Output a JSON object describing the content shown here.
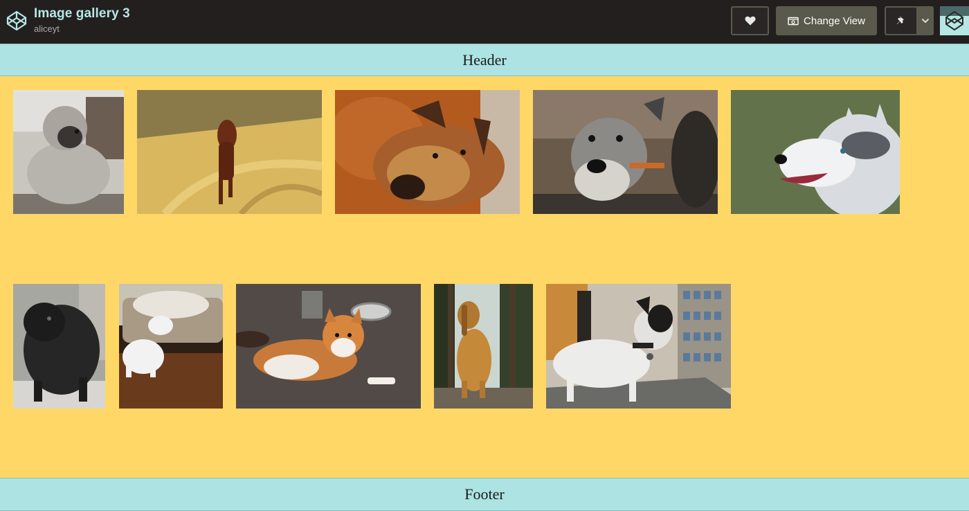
{
  "app": {
    "title": "Image gallery 3",
    "author": "aliceyt"
  },
  "toolbar": {
    "heart_icon": "heart-icon",
    "change_view_label": "Change View",
    "pin_icon": "pin-icon",
    "caret_icon": "chevron-down-icon"
  },
  "page": {
    "header_text": "Header",
    "footer_text": "Footer"
  },
  "colors": {
    "topbar": "#231f1f",
    "title": "#b5e8e5",
    "gallery_background": "#FED766",
    "band_background": "#ade3e2",
    "button_fill": "#5a5a4c"
  },
  "gallery": {
    "rows": [
      [
        {
          "subject": "poodle"
        },
        {
          "subject": "running dog"
        },
        {
          "subject": "resting dog"
        },
        {
          "subject": "schnauzer"
        },
        {
          "subject": "husky"
        }
      ],
      [
        {
          "subject": "black dog"
        },
        {
          "subject": "white dog and couch"
        },
        {
          "subject": "shiba inu"
        },
        {
          "subject": "bloodhound"
        },
        {
          "subject": "jack russell terrier"
        }
      ]
    ]
  }
}
